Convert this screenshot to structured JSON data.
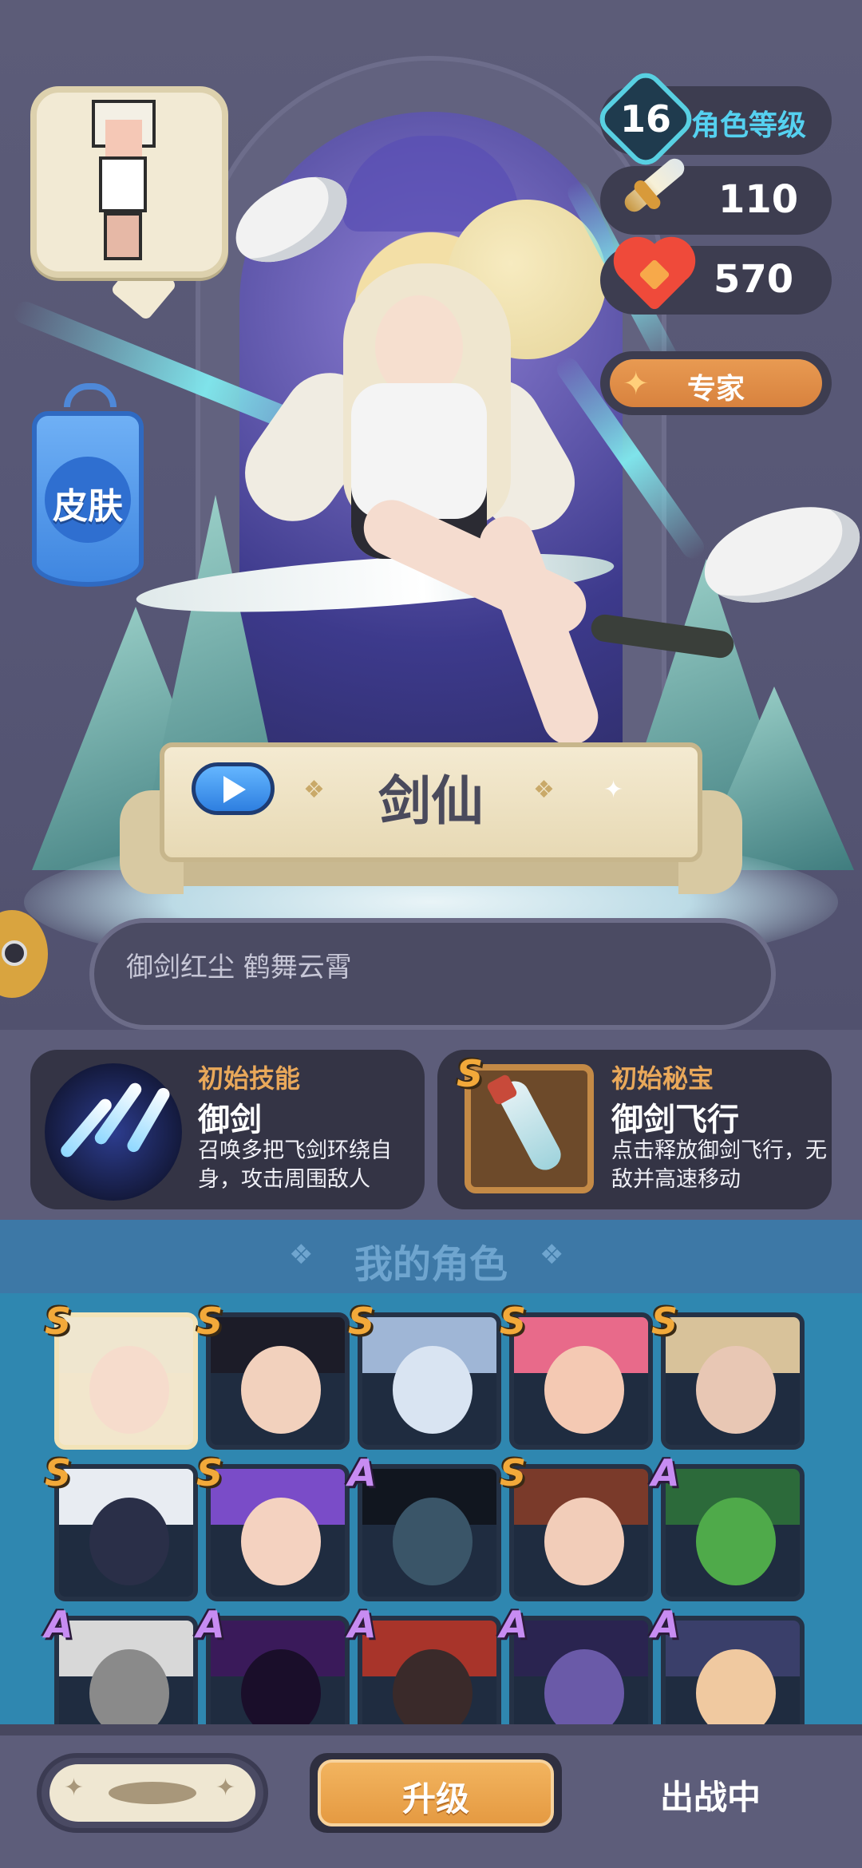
{
  "hero": {
    "character_name": "剑仙",
    "skin_label": "皮肤",
    "description": "御剑红尘 鹤舞云霄"
  },
  "stats": {
    "level_value": "16",
    "level_label": "角色等级",
    "attack_value": "110",
    "hp_value": "570",
    "rank_label": "专家"
  },
  "skill": {
    "title": "初始技能",
    "name": "御剑",
    "description": "召唤多把飞剑环绕自身，攻击周围敌人"
  },
  "treasure": {
    "grade": "S",
    "title": "初始秘宝",
    "name": "御剑飞行",
    "description": "点击释放御剑飞行，无敌并高速移动"
  },
  "roles": {
    "title": "我的角色",
    "grades": [
      "S",
      "S",
      "S",
      "S",
      "S",
      "S",
      "S",
      "A",
      "S",
      "A",
      "A",
      "A",
      "A",
      "A",
      "A"
    ]
  },
  "bottom": {
    "upgrade_label": "升级",
    "deploy_label": "出战中"
  },
  "colors": {
    "accent_orange": "#e59a42",
    "level_cyan": "#55d1f0",
    "skill_title": "#e9a85a",
    "roles_blue": "#2f87b0"
  },
  "icons": [
    "avatar-pixel-icon",
    "skin-banner-icon",
    "level-badge-icon",
    "sword-icon",
    "heart-icon",
    "star-icon",
    "play-icon",
    "flying-swords-icon",
    "flying-sword-treasure-icon",
    "eye-token-icon"
  ]
}
